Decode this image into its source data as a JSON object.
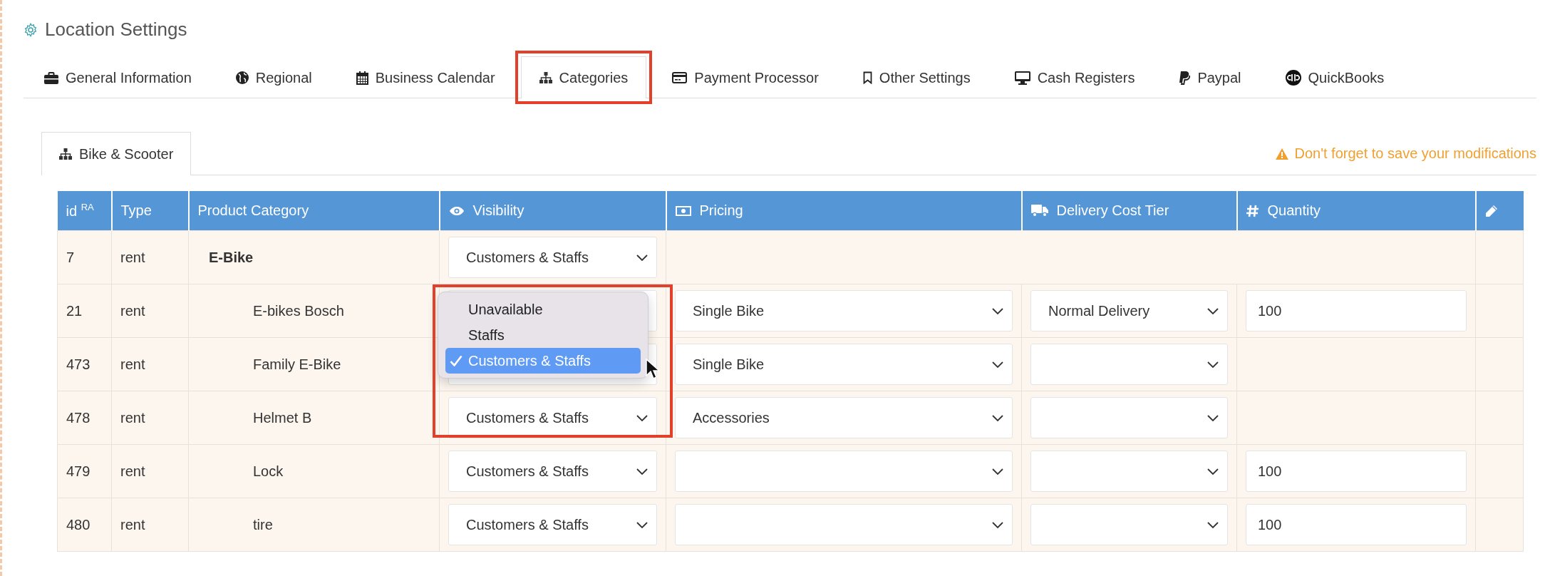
{
  "page_title": "Location Settings",
  "tabs": [
    {
      "label": "General Information",
      "selected": false,
      "highlighted": false
    },
    {
      "label": "Regional",
      "selected": false,
      "highlighted": false
    },
    {
      "label": "Business Calendar",
      "selected": false,
      "highlighted": false
    },
    {
      "label": "Categories",
      "selected": true,
      "highlighted": true
    },
    {
      "label": "Payment Processor",
      "selected": false,
      "highlighted": false
    },
    {
      "label": "Other Settings",
      "selected": false,
      "highlighted": false
    },
    {
      "label": "Cash Registers",
      "selected": false,
      "highlighted": false
    },
    {
      "label": "Paypal",
      "selected": false,
      "highlighted": false
    },
    {
      "label": "QuickBooks",
      "selected": false,
      "highlighted": false
    }
  ],
  "sub_tabs": [
    {
      "label": "Bike & Scooter",
      "selected": true
    }
  ],
  "notice": "Don't forget to save your modifications",
  "table": {
    "columns": [
      "id $^{RA}$",
      "Type",
      "Product Category",
      "Visibility",
      "Pricing",
      "Delivery Cost Tier",
      "Quantity"
    ],
    "rows": [
      {
        "id": "7",
        "type": "rent",
        "category": "E-Bike",
        "visibility": "Customers & Staffs",
        "children": [
          {
            "id": "21",
            "type": "rent",
            "category": "E-bikes Bosch",
            "pricing": "Single Bike",
            "delivery": "Normal Delivery",
            "quantity": "100"
          },
          {
            "id": "473",
            "type": "rent",
            "category": "Family E-Bike",
            "pricing": "Single Bike",
            "visibility_menu": {
              "highlighted": true,
              "options": [
                {
                  "label": "Unavailable",
                  "selected": false
                },
                {
                  "label": "Staffs",
                  "selected": false
                },
                {
                  "label": "Customers & Staffs",
                  "selected": true
                }
              ]
            }
          },
          {
            "id": "478",
            "type": "rent",
            "category": "Helmet B",
            "visibility": "Customers & Staffs",
            "pricing": "Accessories"
          },
          {
            "id": "479",
            "type": "rent",
            "category": "Lock",
            "visibility": "Customers & Staffs",
            "quantity": "100"
          },
          {
            "id": "480",
            "type": "rent",
            "category": "tire",
            "visibility": "Customers & Staffs",
            "quantity": "100"
          }
        ]
      }
    ]
  }
}
